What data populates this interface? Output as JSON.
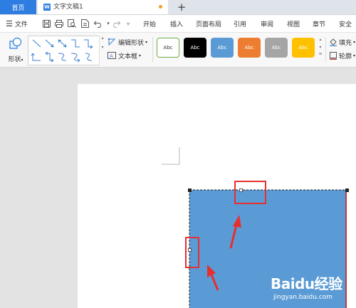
{
  "tabs": {
    "home": "首页",
    "document": "文字文稿1",
    "document_icon": "W",
    "new_tab": "+"
  },
  "menu": {
    "file": "文件",
    "quick_access_icons": [
      "save-icon",
      "print-icon",
      "print-preview-icon",
      "export-icon",
      "undo-icon",
      "redo-icon",
      "customize-quick-access-icon"
    ],
    "tabs": [
      "开始",
      "插入",
      "页面布局",
      "引用",
      "审阅",
      "视图",
      "章节",
      "安全"
    ]
  },
  "ribbon": {
    "shape_label": "形状",
    "edit_shape": "编辑形状",
    "text_box": "文本框",
    "fill": "填充",
    "outline": "轮廓",
    "styles": [
      {
        "label": "Abc",
        "bg": "#ffffff",
        "fg": "#333333",
        "border": "#70ad47"
      },
      {
        "label": "Abc",
        "bg": "#000000",
        "fg": "#ffffff",
        "border": "#000000"
      },
      {
        "label": "Abc",
        "bg": "#5b9bd5",
        "fg": "#ffffff",
        "border": "#5b9bd5",
        "selected": true
      },
      {
        "label": "Abc",
        "bg": "#ed7d31",
        "fg": "#ffffff",
        "border": "#ed7d31"
      },
      {
        "label": "Abc",
        "bg": "#a5a5a5",
        "fg": "#ffffff",
        "border": "#a5a5a5"
      },
      {
        "label": "Abc",
        "bg": "#ffc000",
        "fg": "#ffffff",
        "border": "#ffc000"
      }
    ]
  },
  "colors": {
    "accent": "#2e7de1",
    "shape_fill": "#5b9bd5",
    "annotation": "#e53030"
  },
  "watermark": {
    "brand": "Baidu经验",
    "url": "jingyan.baidu.com"
  }
}
